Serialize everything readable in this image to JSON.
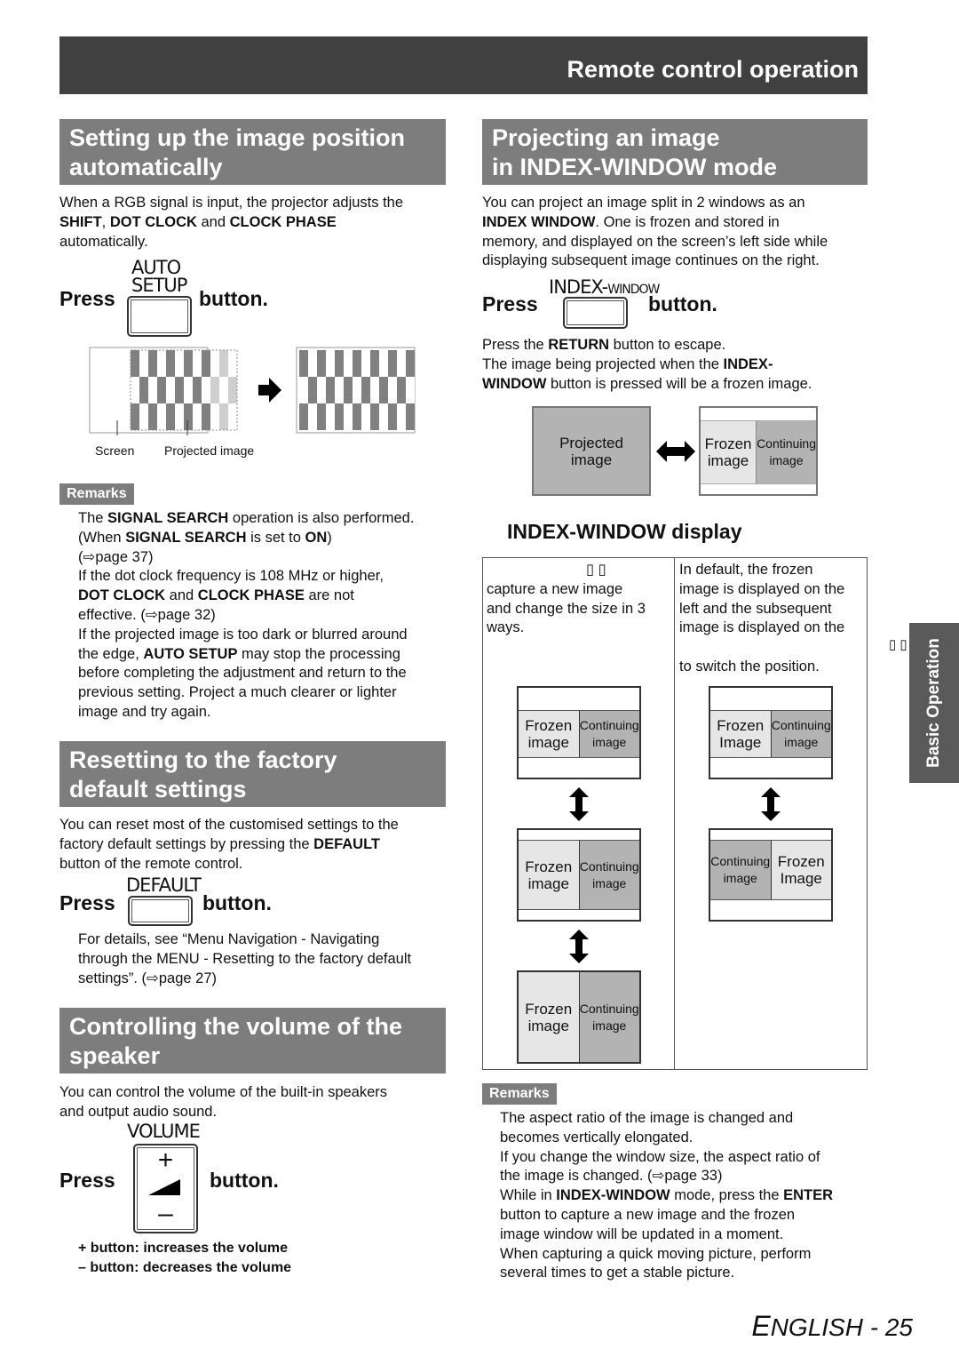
{
  "header": {
    "title": "Remote control operation"
  },
  "side_tab": {
    "label": "Basic Operation",
    "glyph": "▯ ▯"
  },
  "footer": {
    "language_initial": "E",
    "language_rest": "NGLISH",
    "separator": " - ",
    "page_number": "25"
  },
  "left": {
    "auto_setup": {
      "heading_line1": "Setting up the image position",
      "heading_line2": "automatically",
      "intro_1": "When a RGB signal is input, the projector adjusts the",
      "intro_b1": "SHIFT",
      "intro_2": ", ",
      "intro_b2": "DOT CLOCK",
      "intro_3": " and ",
      "intro_b3": "CLOCK PHASE",
      "intro_4": "automatically.",
      "press": "Press",
      "button_label_1": "AUTO",
      "button_label_2": "SETUP",
      "button_suffix": "button.",
      "caption_screen": "Screen",
      "caption_projected": "Projected image",
      "remarks_label": "Remarks",
      "remarks": {
        "r1_a": "The ",
        "r1_b": "SIGNAL SEARCH",
        "r1_c": " operation is also performed.",
        "r2_a": "(When ",
        "r2_b": "SIGNAL SEARCH",
        "r2_c": " is set to ",
        "r2_d": "ON",
        "r2_e": ")",
        "r3": "(⇨page 37)",
        "r4": "If the dot clock frequency is 108 MHz or higher,",
        "r5_b1": "DOT CLOCK",
        "r5_a": " and ",
        "r5_b2": "CLOCK PHASE",
        "r5_c": " are not",
        "r6": "effective. (⇨page 32)",
        "r7": "If the projected image is too dark or blurred around",
        "r8_a": "the edge, ",
        "r8_b": "AUTO SETUP",
        "r8_c": " may stop the processing",
        "r9": "before completing the adjustment and return to the",
        "r10": "previous setting. Project a much clearer or lighter",
        "r11": "image and try again."
      }
    },
    "factory_reset": {
      "heading_line1": "Resetting to the factory",
      "heading_line2": "default settings",
      "intro_1": "You can reset most of the customised settings to the",
      "intro_2": "factory default settings by pressing the ",
      "intro_b": "DEFAULT",
      "intro_3": "button of the remote control.",
      "press": "Press",
      "button_label": "DEFAULT",
      "button_suffix": "button.",
      "detail_1": "For details, see “Menu Navigation - Navigating",
      "detail_2": "through the MENU - Resetting to the factory default",
      "detail_3": "settings”. (⇨page 27)"
    },
    "volume": {
      "heading_line1": "Controlling the volume of the",
      "heading_line2": "speaker",
      "intro_1": "You can control the volume of the built-in speakers",
      "intro_2": "and output audio sound.",
      "press": "Press",
      "button_label": "VOLUME",
      "plus": "+",
      "minus": "–",
      "button_suffix": "button.",
      "note_plus": "+ button: increases the volume",
      "note_minus": "– button: decreases the volume"
    }
  },
  "right": {
    "index_window": {
      "heading_line1": "Projecting an image",
      "heading_line2": "in INDEX-WINDOW mode",
      "intro_1": "You can project an image split in 2 windows as an",
      "intro_b": "INDEX WINDOW",
      "intro_2": ". One is frozen and stored in",
      "intro_3": "memory, and displayed on the screen’s left side while",
      "intro_4": "displaying subsequent image continues on the right.",
      "press": "Press",
      "button_label_big": "INDEX-",
      "button_label_small": "WINDOW",
      "button_suffix": "button.",
      "after_1a": "Press the ",
      "after_1b": "RETURN",
      "after_1c": " button to escape.",
      "after_2a": "The image being projected when the ",
      "after_2b": "INDEX-",
      "after_3a": "WINDOW",
      "after_3b": " button is pressed will be a frozen image.",
      "diagram": {
        "projected_1": "Projected",
        "projected_2": "image",
        "frozen_1": "Frozen",
        "frozen_2": "image",
        "cont_1": "Continuing",
        "cont_2": "image"
      },
      "display_heading": "INDEX-WINDOW display",
      "table": {
        "left_glyph": "▯ ▯",
        "left_1": "capture a new image",
        "left_2": "and change the size in 3",
        "left_3": "ways.",
        "right_1": "In default, the frozen",
        "right_2": "image is displayed on the",
        "right_3": "left and the subsequent",
        "right_4": "image is displayed on the",
        "right_5": "to switch the position.",
        "frozen_1": "Frozen",
        "frozen_2": "image",
        "frozen_2_cap": "Image",
        "cont_1": "Continuing",
        "cont_2": "image"
      },
      "remarks_label": "Remarks",
      "remarks": {
        "r1": "The aspect ratio of the image is changed and",
        "r2": "becomes vertically elongated.",
        "r3": "If you change the window size, the aspect ratio of",
        "r4": "the image is changed. (⇨page 33)",
        "r5_a": "While in ",
        "r5_b": "INDEX-WINDOW",
        "r5_c": " mode, press the ",
        "r5_d": "ENTER",
        "r6": "button to capture a new image and the frozen",
        "r7": "image window will be updated in a moment.",
        "r8": "When capturing a quick moving picture, perform",
        "r9": "several times to get a stable picture."
      }
    }
  }
}
